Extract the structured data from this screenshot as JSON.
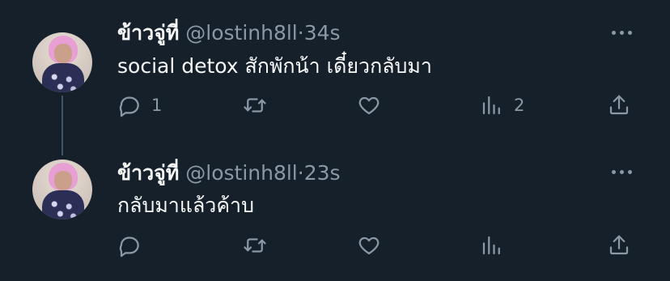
{
  "tweets": [
    {
      "name": "ข้าวจู่ที่",
      "handle": "@lostinh8ll",
      "time": "34s",
      "text": "social detox สักพักน้า เดี๋ยวกลับมา",
      "reply_count": "1",
      "views_count": "2"
    },
    {
      "name": "ข้าวจู่ที่",
      "handle": "@lostinh8ll",
      "time": "23s",
      "text": "กลับมาแล้วค้าบ",
      "reply_count": "",
      "views_count": ""
    }
  ],
  "separator": "·",
  "colors": {
    "background": "#15202b",
    "muted": "#8b98a5",
    "text": "#f7f9f9",
    "thread_line": "#425364"
  },
  "icons": [
    "reply-icon",
    "retweet-icon",
    "like-icon",
    "views-icon",
    "share-icon",
    "more-icon"
  ]
}
